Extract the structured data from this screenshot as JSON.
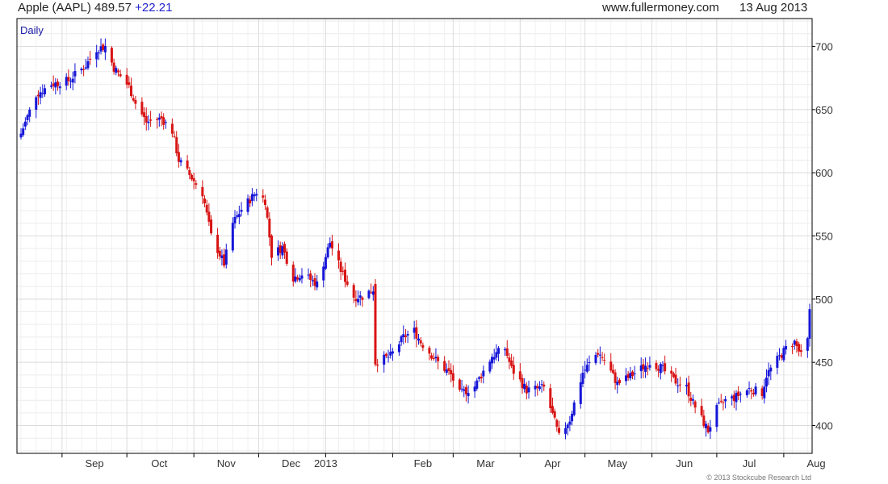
{
  "header": {
    "title": "Apple (AAPL) 489.57",
    "change": "+22.21",
    "site": "www.fullermoney.com",
    "date": "13 Aug 2013"
  },
  "colors": {
    "up": "#1515d8",
    "down": "#d81414",
    "grid": "#dcdcdc",
    "axis": "#000000"
  },
  "chart_data": {
    "type": "candlestick",
    "period_label": "Daily",
    "copyright": "© 2013 Stockcube Research Ltd",
    "y_axis_side": "right",
    "ylim": [
      378,
      722
    ],
    "yticks": [
      400,
      450,
      500,
      550,
      600,
      650,
      700
    ],
    "grid": true,
    "x_axis": {
      "start": "2012-08-13",
      "end": "2013-08-13",
      "month_ticks": [
        {
          "label": "Sep",
          "date": "2012-09-01"
        },
        {
          "label": "Oct",
          "date": "2012-10-01"
        },
        {
          "label": "Nov",
          "date": "2012-11-01"
        },
        {
          "label": "Dec",
          "date": "2012-12-01"
        },
        {
          "label": "2013",
          "date": "2013-01-01"
        },
        {
          "label": "Feb",
          "date": "2013-02-01"
        },
        {
          "label": "Mar",
          "date": "2013-03-01"
        },
        {
          "label": "Apr",
          "date": "2013-04-01"
        },
        {
          "label": "May",
          "date": "2013-05-01"
        },
        {
          "label": "Jun",
          "date": "2013-06-01"
        },
        {
          "label": "Jul",
          "date": "2013-07-01"
        },
        {
          "label": "Aug",
          "date": "2013-08-01"
        }
      ]
    },
    "price_path": [
      [
        "2012-08-13",
        631
      ],
      [
        "2012-08-20",
        662
      ],
      [
        "2012-08-27",
        670
      ],
      [
        "2012-09-04",
        673
      ],
      [
        "2012-09-12",
        685
      ],
      [
        "2012-09-17",
        698
      ],
      [
        "2012-09-21",
        700
      ],
      [
        "2012-09-25",
        683
      ],
      [
        "2012-10-02",
        668
      ],
      [
        "2012-10-05",
        655
      ],
      [
        "2012-10-10",
        640
      ],
      [
        "2012-10-17",
        643
      ],
      [
        "2012-10-22",
        633
      ],
      [
        "2012-10-25",
        610
      ],
      [
        "2012-10-31",
        596
      ],
      [
        "2012-11-05",
        584
      ],
      [
        "2012-11-09",
        550
      ],
      [
        "2012-11-15",
        528
      ],
      [
        "2012-11-19",
        560
      ],
      [
        "2012-11-23",
        571
      ],
      [
        "2012-11-30",
        585
      ],
      [
        "2012-12-04",
        578
      ],
      [
        "2012-12-07",
        535
      ],
      [
        "2012-12-12",
        541
      ],
      [
        "2012-12-17",
        517
      ],
      [
        "2012-12-21",
        520
      ],
      [
        "2012-12-28",
        512
      ],
      [
        "2013-01-03",
        545
      ],
      [
        "2013-01-08",
        523
      ],
      [
        "2013-01-14",
        502
      ],
      [
        "2013-01-18",
        502
      ],
      [
        "2013-01-23",
        508
      ],
      [
        "2013-01-24",
        450
      ],
      [
        "2013-01-31",
        455
      ],
      [
        "2013-02-06",
        470
      ],
      [
        "2013-02-11",
        475
      ],
      [
        "2013-02-14",
        466
      ],
      [
        "2013-02-22",
        450
      ],
      [
        "2013-02-28",
        440
      ],
      [
        "2013-03-04",
        425
      ],
      [
        "2013-03-11",
        431
      ],
      [
        "2013-03-15",
        443
      ],
      [
        "2013-03-19",
        455
      ],
      [
        "2013-03-25",
        461
      ],
      [
        "2013-03-28",
        445
      ],
      [
        "2013-04-04",
        428
      ],
      [
        "2013-04-12",
        430
      ],
      [
        "2013-04-17",
        403
      ],
      [
        "2013-04-19",
        391
      ],
      [
        "2013-04-24",
        405
      ],
      [
        "2013-04-30",
        442
      ],
      [
        "2013-05-07",
        458
      ],
      [
        "2013-05-10",
        452
      ],
      [
        "2013-05-16",
        433
      ],
      [
        "2013-05-22",
        439
      ],
      [
        "2013-05-31",
        450
      ],
      [
        "2013-06-05",
        446
      ],
      [
        "2013-06-11",
        436
      ],
      [
        "2013-06-17",
        430
      ],
      [
        "2013-06-20",
        418
      ],
      [
        "2013-06-25",
        402
      ],
      [
        "2013-06-27",
        396
      ],
      [
        "2013-07-01",
        413
      ],
      [
        "2013-07-05",
        420
      ],
      [
        "2013-07-09",
        422
      ],
      [
        "2013-07-16",
        429
      ],
      [
        "2013-07-22",
        426
      ],
      [
        "2013-07-24",
        440
      ],
      [
        "2013-07-29",
        452
      ],
      [
        "2013-08-02",
        461
      ],
      [
        "2013-08-06",
        466
      ],
      [
        "2013-08-09",
        455
      ],
      [
        "2013-08-12",
        467
      ],
      [
        "2013-08-13",
        490
      ]
    ]
  }
}
